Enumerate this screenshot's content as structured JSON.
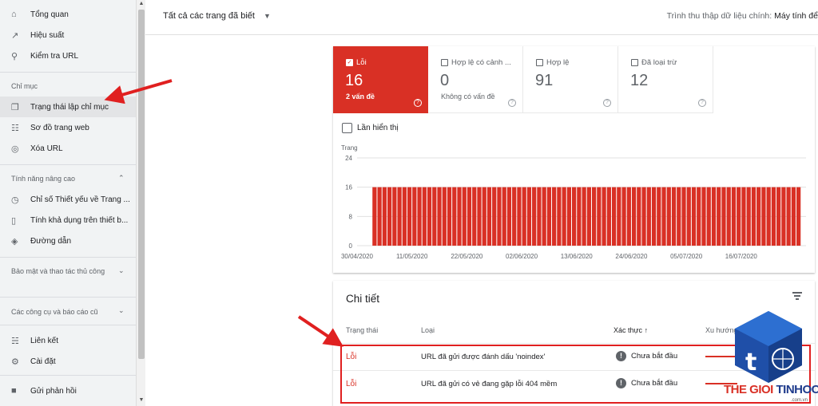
{
  "sidebar": {
    "items_top": [
      {
        "icon": "home-icon",
        "label": "Tổng quan"
      },
      {
        "icon": "trending-up-icon",
        "label": "Hiệu suất"
      },
      {
        "icon": "search-icon",
        "label": "Kiểm tra URL"
      }
    ],
    "section_index": "Chỉ mục",
    "items_index": [
      {
        "icon": "file-copy-icon",
        "label": "Trạng thái lập chỉ mục"
      },
      {
        "icon": "sitemap-icon",
        "label": "Sơ đồ trang web"
      },
      {
        "icon": "eye-off-icon",
        "label": "Xóa URL"
      }
    ],
    "section_advanced": "Tính năng nâng cao",
    "items_advanced": [
      {
        "icon": "gauge-icon",
        "label": "Chỉ số Thiết yếu về Trang ..."
      },
      {
        "icon": "phone-icon",
        "label": "Tính khả dụng trên thiết b..."
      },
      {
        "icon": "layers-icon",
        "label": "Đường dẫn"
      }
    ],
    "section_security": "Bảo mật và thao tác thủ công",
    "section_legacy": "Các công cụ và báo cáo cũ",
    "items_bottom": [
      {
        "icon": "network-icon",
        "label": "Liên kết"
      },
      {
        "icon": "gear-icon",
        "label": "Cài đặt"
      },
      {
        "icon": "feedback-icon",
        "label": "Gửi phản hồi"
      }
    ]
  },
  "topbar": {
    "property": "Tất cả các trang đã biết",
    "crawler_label": "Trình thu thập dữ liệu chính:",
    "crawler_value": "Máy tính để"
  },
  "tiles": [
    {
      "label": "Lỗi",
      "value": "16",
      "sub": "2 vấn đề",
      "checked": true
    },
    {
      "label": "Hợp lệ có cảnh ...",
      "value": "0",
      "sub": "Không có vấn đề",
      "checked": false
    },
    {
      "label": "Hợp lệ",
      "value": "91",
      "sub": "",
      "checked": false
    },
    {
      "label": "Đã loại trừ",
      "value": "12",
      "sub": "",
      "checked": false
    }
  ],
  "impressions_label": "Lần hiển thị",
  "colors": {
    "error": "#d93025",
    "accent_text": "#5f6368"
  },
  "chart_data": {
    "type": "bar",
    "ylabel": "Trang",
    "ylim": [
      0,
      24
    ],
    "yticks": [
      "24",
      "16",
      "8",
      "0"
    ],
    "xtick_labels": [
      "30/04/2020",
      "11/05/2020",
      "22/05/2020",
      "02/06/2020",
      "13/06/2020",
      "24/06/2020",
      "05/07/2020",
      "16/07/2020"
    ],
    "num_empty_leading_days": 3,
    "num_bars": 86,
    "value": 16,
    "series": [
      {
        "values": [
          16
        ]
      }
    ]
  },
  "details": {
    "title": "Chi tiết",
    "columns": [
      "Trạng thái",
      "Loại",
      "Xác thực",
      "Xu hướng"
    ],
    "sort_arrow": "↑",
    "rows": [
      {
        "status": "Lỗi",
        "type": "URL đã gửi được đánh dấu 'noindex'",
        "validation": "Chưa bắt đầu"
      },
      {
        "status": "Lỗi",
        "type": "URL đã gửi có vẻ đang gặp lỗi 404 mềm",
        "validation": "Chưa bắt đầu"
      }
    ]
  },
  "logo": {
    "part1": "THE GIOI",
    "part2": "TINHOC",
    "domain": ".com.vn",
    "letter": "t"
  }
}
